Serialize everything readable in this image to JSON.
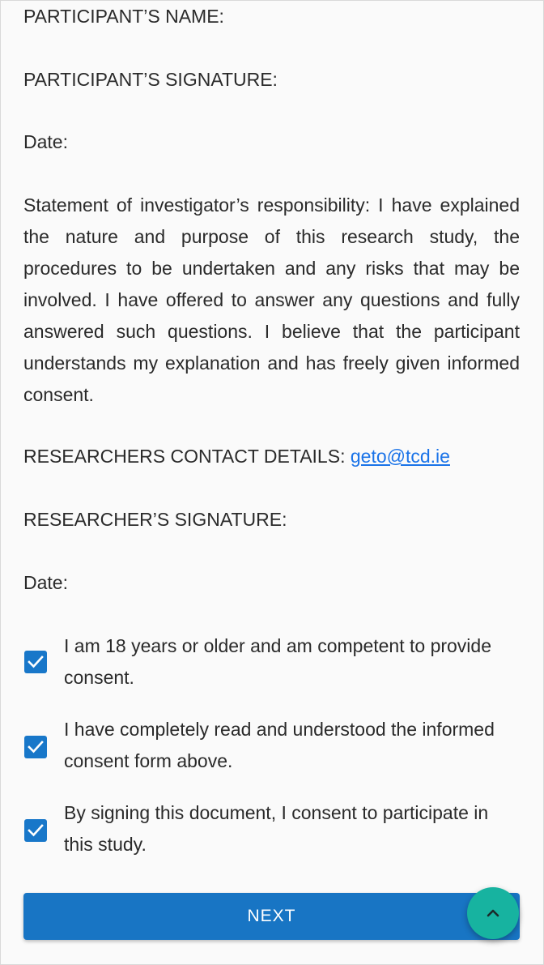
{
  "form": {
    "participant_name_label": "PARTICIPANT’S NAME:",
    "participant_signature_label": "PARTICIPANT’S SIGNATURE:",
    "participant_date_label": "Date:",
    "investigator_statement": "Statement of investigator’s responsibility: I have explained the nature and purpose of this research study, the procedures to be undertaken and any risks that may be involved. I have offered to answer any questions and fully answered such questions. I believe that the participant understands my explanation and has freely given informed consent.",
    "contact_label": "RESEARCHERS CONTACT DETAILS:",
    "contact_email": "geto@tcd.ie",
    "researcher_signature_label": "RESEARCHER’S SIGNATURE:",
    "researcher_date_label": "Date:"
  },
  "consents": [
    {
      "label": "I am 18 years or older and am competent to provide consent.",
      "checked": true
    },
    {
      "label": "I have completely read and understood the informed consent form above.",
      "checked": true
    },
    {
      "label": "By signing this document, I consent to participate in this study.",
      "checked": true
    }
  ],
  "actions": {
    "next_label": "NEXT",
    "scroll_top_icon": "chevron-up-icon"
  },
  "colors": {
    "button": "#1875c4",
    "fab": "#17b3a0",
    "checkbox": "#1877c9",
    "link": "#1a73e8"
  }
}
